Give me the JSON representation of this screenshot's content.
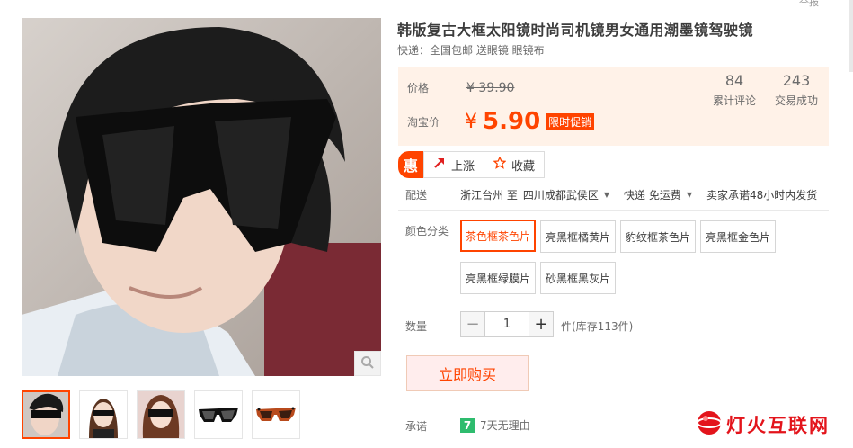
{
  "top": {
    "report_label": "举报"
  },
  "product": {
    "title": "韩版复古大框太阳镜时尚司机镜男女通用潮墨镜驾驶镜",
    "subtitle": "快递：全国包邮 送眼镜 眼镜布"
  },
  "price": {
    "price_label": "价格",
    "original": "¥ 39.90",
    "taobao_label": "淘宝价",
    "currency": "¥",
    "current": "5.90",
    "promo_tag": "限时促销",
    "reviews_count": "84",
    "reviews_label": "累计评论",
    "sales_count": "243",
    "sales_label": "交易成功"
  },
  "actions": {
    "hui_icon": "惠",
    "rise_label": "上涨",
    "fav_label": "收藏"
  },
  "shipping": {
    "label": "配送",
    "from": "浙江台州 至",
    "to": "四川成都武侯区",
    "method": "快递 免运费",
    "promise": "卖家承诺48小时内发货"
  },
  "colors": {
    "label": "颜色分类",
    "options": [
      "茶色框茶色片",
      "亮黑框橘黄片",
      "豹纹框茶色片",
      "亮黑框金色片",
      "亮黑框绿膜片",
      "砂黑框黑灰片"
    ],
    "selected_index": 0
  },
  "quantity": {
    "label": "数量",
    "minus": "−",
    "value": "1",
    "plus": "+",
    "stock": "件(库存113件)"
  },
  "buy": {
    "label": "立即购买"
  },
  "promise": {
    "label": "承诺",
    "badge": "7",
    "text": "7天无理由"
  },
  "watermark": {
    "text": "灯火互联网"
  },
  "colors_theme": {
    "accent": "#ff4400",
    "price_bg": "#fff2e8"
  }
}
